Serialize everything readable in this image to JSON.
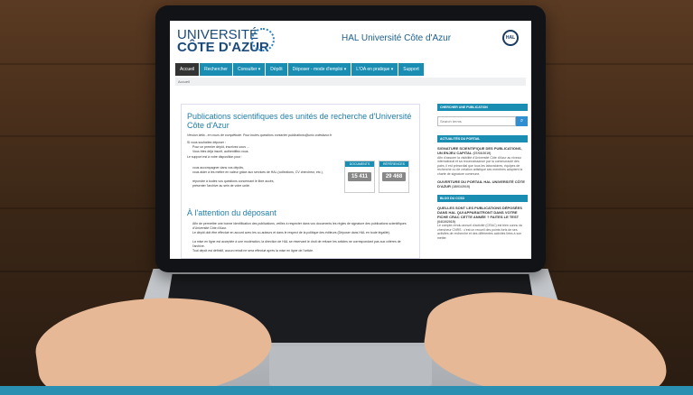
{
  "site": {
    "logo_line1": "UNIVERSITÉ",
    "logo_line2": "CÔTE D'AZUR",
    "header_title": "HAL Université Côte d'Azur",
    "hal_badge": "HAL"
  },
  "nav": {
    "items": [
      "Accueil",
      "Rechercher",
      "Consulter ▾",
      "Dépôt",
      "Déposer - mode d'emploi ▾",
      "L'OA en pratique ▾",
      "Support"
    ]
  },
  "breadcrumb": "Accueil",
  "main": {
    "title": "Publications scientifiques des unités de recherche d'Université Côte d'Azur",
    "beta": "Version bêta - en cours de complétude. Pour toutes questions contacter publications@univ-cotedazur.fr",
    "intro": "Si vous souhaitez déposer :",
    "bullet1": "Pour un premier dépôt, inscrivez-vous ...",
    "bullet2": "Vous êtes déjà inscrit, authentifiez-vous.",
    "support_intro": "Le support est à votre disposition pour :",
    "support1": "vous accompagner dans vos dépôts,",
    "support2": "vous aider à les mettre en valeur grâce aux services de HAL (collections, CV chercheur, etc.),",
    "support3": "répondre à toutes vos questions concernant le libre accès,",
    "support4": "présenter l'archive au sein de votre unité.",
    "section_title": "À l'attention du déposant",
    "att1": "Afin de permettre une bonne identification des publications, veillez à respecter dans vos documents les règles de signature des publications scientifiques d'Université Côte d'Azur.",
    "att2": "Le dépôt doit être effectué en accord avec les co-auteurs et dans le respect de la politique des éditeurs (Déposer dans HAL en toute légalité).",
    "att3": "La mise en ligne est acceptée à une modération, la direction de HAL se réservant le droit de refuser les articles ne correspondant pas aux critères de l'archive.",
    "att4": "Tout dépôt est définitif, aucun retrait ne sera effectué après la mise en ligne de l'article."
  },
  "stats": {
    "documents_label": "DOCUMENTS",
    "documents_value": "15 411",
    "references_label": "RÉFÉRENCES",
    "references_value": "29 468"
  },
  "sidebar": {
    "search_head": "CHERCHER UNE PUBLICATION",
    "search_placeholder": "Search terms",
    "news_head": "ACTUALITÉS DU PORTAIL",
    "news1_title": "SIGNATURE SCIENTIFIQUE DES PUBLICATIONS, UN ENJEU CAPITAL",
    "news1_date": "(07/03/2019)",
    "news1_text": "Afin d'assurer la visibilité d'Université Côte d'Azur au niveau international et sa reconnaissance par la communauté des pairs, il est primordial que tous les laboratoires, équipes de recherche ou de création artistique ses membres adoptent la charte de signature commune.",
    "news2_title": "OUVERTURE DU PORTAIL HAL UNIVERSITÉ CÔTE D'AZUR",
    "news2_date": "(18/01/2019)",
    "blog_head": "BLOG DU CCSD",
    "blog_title": "QUELLES SONT LES PUBLICATIONS DÉPOSÉES DANS HAL QUI APPARAITRONT DANS VOTRE FICHE CRAC CETTE ANNÉE ? FAITES LE TEST",
    "blog_date": "(04/10/2019)",
    "blog_text": "Le compte-rendu annuel d'activité (CRAC) est bien connu du chercheur CNRS : c'est un recueil des points forts de ses activités de recherche et des différentes activités liées à son métier."
  },
  "colors": {
    "accent": "#1a8db3",
    "title_blue": "#1f7da8",
    "bottom_bar": "#2a8fb0"
  }
}
